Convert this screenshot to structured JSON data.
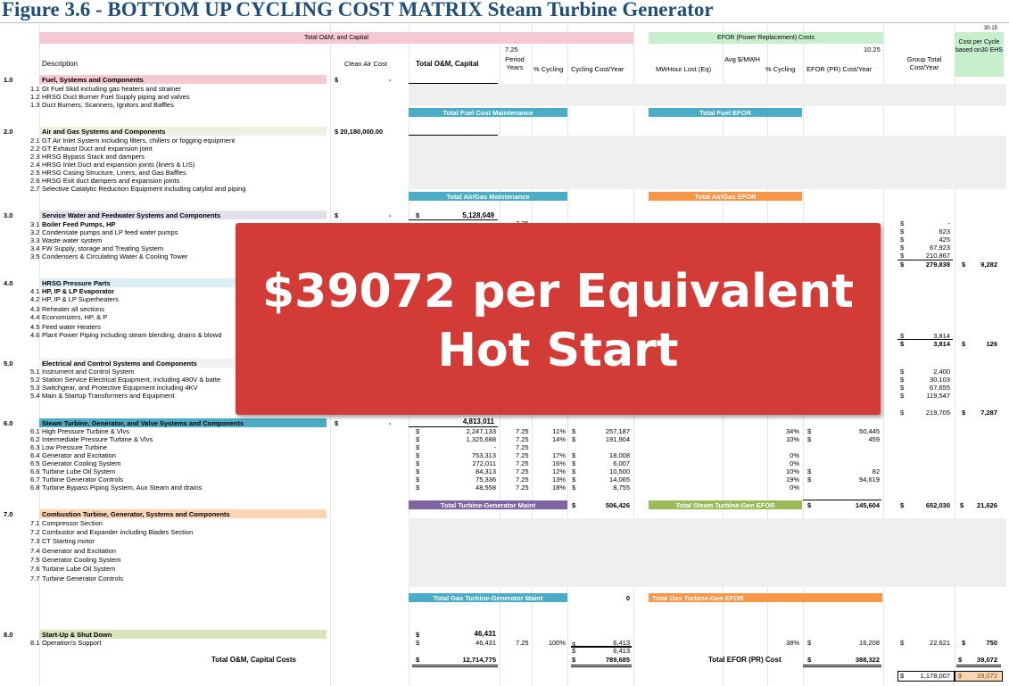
{
  "title": "Figure 3.6 - BOTTOM UP CYCLING COST MATRIX Steam Turbine Generator",
  "corner_value": "30.15",
  "header": {
    "total_om_capital_band": "Total O&M, and Capital",
    "efor_band": "EFOR (Power Replacement) Costs",
    "cost_per_cycle": "Cost per Cycle based on30 EHS",
    "description": "Description",
    "clean_air_cost": "Clean Air Cost",
    "total_om_capital": "Total O&M, Capital",
    "period_years_value": "7.25",
    "period_years": "Period Years",
    "pct_cycling": "% Cycling",
    "cycling_cost_year": "Cycling Cost/Year",
    "efor_value": "10.25",
    "mwhour_lost": "MWHour Lost (Eq)",
    "avg_mwh": "Avg $/MWH",
    "pct_cycling2": "% Cycling",
    "efor_cost_year": "EFOR (PR) Cost/Year",
    "group_total": "Group Total Cost/Year"
  },
  "sections": {
    "s1": {
      "num": "1.0",
      "title": "Fuel, Systems and Components",
      "clean_dollar": "$",
      "clean_val": "-",
      "items": [
        [
          "1.1",
          "Gt Fuel Skid including gas heaters and strainer"
        ],
        [
          "1.2",
          "HRSG Duct Burner Fuel Supply piping and valves"
        ],
        [
          "1.3",
          "Duct Burners, Scanners, Ignitors and Baffles"
        ]
      ],
      "maint": "Total Fuel Cost Maintenance",
      "efor": "Total Fuel EFOR"
    },
    "s2": {
      "num": "2.0",
      "title": "Air and Gas Systems and Components",
      "clean_val": "$  20,180,000.00",
      "items": [
        [
          "2.1",
          "GT Air Inlet System including filters, chillers or fogging equipment"
        ],
        [
          "2.2",
          "GT Exhaust Duct and expansion joint"
        ],
        [
          "2.3",
          "HRSG Bypass Stack and dampers"
        ],
        [
          "2.4",
          "HRSG Inlet Duct and expansion joints (liners & LIS)"
        ],
        [
          "2.5",
          "HRSG Casing Structure, Liners, and Gas Baffles"
        ],
        [
          "2.6",
          "HRSG Exit duct dampers and expansion joints"
        ],
        [
          "2.7",
          "Selective Catalytic Reduction Equipment including catylist and piping"
        ]
      ],
      "maint": "Total Air/Gas Maintenance",
      "efor": "Total Air/Gas EFOR"
    },
    "s3": {
      "num": "3.0",
      "title": "Service Water and Feedwater Systems and Components",
      "clean_dollar": "$",
      "clean_val": "-",
      "total": "5,128,049",
      "period": "7.25",
      "items": [
        [
          "3.1",
          "Boiler Feed Pumps, HP"
        ],
        [
          "3.2",
          "Condensate pumps and LP feed water pumps"
        ],
        [
          "3.3",
          "Waste water system"
        ],
        [
          "3.4",
          "FW Supply, storage and Treating System"
        ],
        [
          "3.5",
          "Condensers & Circulating Water & Cooling Tower"
        ]
      ],
      "group": [
        "-",
        "623",
        "425",
        "67,923",
        "210,867"
      ],
      "group_total": "279,838",
      "cycle": "9,282"
    },
    "s4": {
      "num": "4.0",
      "title": "HRSG Pressure Parts",
      "items": [
        [
          "4.1",
          "HP, IP & LP Evaporator"
        ],
        [
          "4.2",
          "HP, IP & LP Superheaters"
        ],
        [
          "4.3",
          "Reheater all sections"
        ],
        [
          "4.4",
          "Economizers, HP, & P"
        ],
        [
          "4.5",
          "Feed water Heaters"
        ],
        [
          "4.6",
          "Plant Power Piping including steam blending, drains & blowd"
        ]
      ],
      "group": "3,814",
      "group_total": "3,814",
      "cycle": "126"
    },
    "s5": {
      "num": "5.0",
      "title": "Electrical and Control Systems and Components",
      "items": [
        [
          "5.1",
          "Instrument and Control System"
        ],
        [
          "5.2",
          "Station Service Electrical Equipment, including 480V & batte"
        ],
        [
          "5.3",
          "Switchgear, and Protective Equipment including 4KV"
        ],
        [
          "5.4",
          "Main & Startup Transformers and Equipment"
        ]
      ],
      "group": [
        "2,400",
        "30,103",
        "67,655",
        "119,547"
      ],
      "group_total": "219,705",
      "cycle": "7,287"
    },
    "s6": {
      "num": "6.0",
      "title": "Steam Turbine, Generator, and Valve Systems and Components",
      "clean_dollar": "$",
      "clean_val": "-",
      "total": "4,813,011",
      "items": [
        [
          "6.1",
          "High Pressure Turbine & Vlvs",
          "2,247,133",
          "7.25",
          "11%",
          "257,187",
          "34%",
          "50,445"
        ],
        [
          "6.2",
          "Intermediate Pressure Turbine & Vlvs",
          "1,325,688",
          "7.25",
          "14%",
          "191,904",
          "10%",
          "459"
        ],
        [
          "6.3",
          "Low Pressure Turbine",
          "-",
          "7.25",
          "",
          "",
          "",
          ""
        ],
        [
          "6.4",
          "Generator and Excitation",
          "753,313",
          "7.25",
          "17%",
          "18,008",
          "0%",
          ""
        ],
        [
          "6.5",
          "Generator Cooling System",
          "272,011",
          "7.25",
          "16%",
          "6,007",
          "0%",
          ""
        ],
        [
          "6.6",
          "Turbine Lube Oil System",
          "84,313",
          "7.25",
          "12%",
          "10,500",
          "10%",
          "82"
        ],
        [
          "6.7",
          "Turbine Generator Controls",
          "75,336",
          "7.25",
          "13%",
          "14,065",
          "19%",
          "94,619"
        ],
        [
          "6.8",
          "Turbine Bypass Piping System, Aux Steam and drains",
          "48,558",
          "7.25",
          "18%",
          "8,755",
          "0%",
          ""
        ]
      ],
      "maint": "Total Turbine-Generator Maint",
      "maint_val": "506,426",
      "efor": "Total Steam Turbine-Gen EFOR",
      "efor_val": "145,604",
      "group_total": "652,030",
      "cycle": "21,626"
    },
    "s7": {
      "num": "7.0",
      "title": "Combustion Turbine, Generator,  Systems and Components",
      "items": [
        [
          "7.1",
          "Compressor Section"
        ],
        [
          "7.2",
          "Combustor and  Expander including Blades Section"
        ],
        [
          "7.3",
          "CT Starting motor"
        ],
        [
          "7.4",
          "Generator and Excitation"
        ],
        [
          "7.5",
          "Generator Cooling System"
        ],
        [
          "7.6",
          "Turbine Lube Oil System"
        ],
        [
          "7.7",
          "Turbine Generator Controls"
        ]
      ],
      "maint": "Total Gas Turbine-Generator Maint",
      "maint_val": "0",
      "efor": "Total Gas Turbine-Gen EFOR"
    },
    "s8": {
      "num": "8.0",
      "title": "Start-Up & Shut Down",
      "total": "46,431",
      "item": [
        "8.1",
        "Operation's Support",
        "46,431",
        "7.25",
        "100%",
        "6,413",
        "38%",
        "16,208",
        "22,621",
        "750"
      ]
    }
  },
  "totals": {
    "om_label": "Total O&M, Capital Costs",
    "om_val": "12,714,775",
    "cyc1": "6,413",
    "cyc2": "789,685",
    "efor_label": "Total EFOR (PR) Cost",
    "efor_val": "388,322",
    "cost_per_cycle": "39,072",
    "grand_group": "1,178,007",
    "grand_cycle": "39,072"
  },
  "dollar": "$",
  "banner": {
    "line1": "$39072 per Equivalent",
    "line2": "Hot Start"
  },
  "colors": {
    "title": "#1f4e79",
    "banner": "#d33b37",
    "pink": "#f6c8d2",
    "green": "#c6efce",
    "blue": "#4bacc6",
    "orange": "#f79646",
    "purple": "#8064a2",
    "olive": "#9bbb59"
  }
}
